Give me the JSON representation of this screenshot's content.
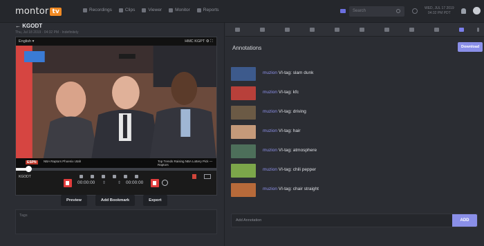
{
  "app": {
    "logo_text": "montor",
    "logo_mark": "tv",
    "nav": [
      "Recordings",
      "Clips",
      "Viewer",
      "Monitor",
      "Reports"
    ],
    "search_placeholder": "Search",
    "clock": [
      "WED, JUL 17 2019",
      "04:32 PM PDT"
    ]
  },
  "left": {
    "channel": "KGODT",
    "subtitle": "Thu, Jul 18 2019 · 04:32 PM · Indefinitely",
    "video": {
      "language": "English",
      "controls_right": "HMC  KGPT  ⚙  ⛶",
      "ticker_brand": "ESPN",
      "ticker_left": "NBA  Raptors   Phoenix   Utah",
      "ticker_right": "Top Trends Raising NBA Lottery Pick — Raptors",
      "station_label": "KGODT",
      "progress_fraction": 0.06
    },
    "start_time": "00:00:00",
    "end_time": "00:00:00",
    "buttons": {
      "preview": "Preview",
      "bookmark": "Add Bookmark",
      "export": "Export"
    },
    "notes_placeholder": "Tags"
  },
  "right": {
    "title": "Annotations",
    "download_label": "Download",
    "annotations": [
      {
        "keyword": "muzion",
        "text": "VI-tag: slam dunk",
        "color": "#3d5a8c"
      },
      {
        "keyword": "muzion",
        "text": "VI-tag: kfc",
        "color": "#b8403a"
      },
      {
        "keyword": "muzion",
        "text": "VI-tag: driving",
        "color": "#6b5a45"
      },
      {
        "keyword": "muzion",
        "text": "VI-tag: hair",
        "color": "#c59a7a"
      },
      {
        "keyword": "muzion",
        "text": "VI-tag: atmosphere",
        "color": "#4d6f5a"
      },
      {
        "keyword": "muzion",
        "text": "VI-tag: chili pepper",
        "color": "#7ca64a"
      },
      {
        "keyword": "muzion",
        "text": "VI-tag: chair straight",
        "color": "#b76a3a"
      }
    ],
    "add_placeholder": "Add Annotation",
    "add_label": "ADD"
  }
}
